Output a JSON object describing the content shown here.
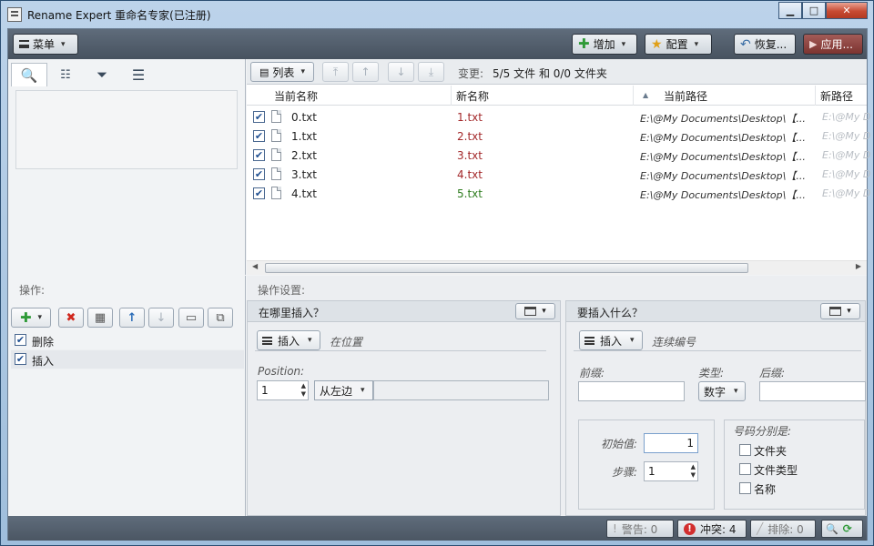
{
  "window": {
    "title": "Rename Expert 重命名专家(已注册)"
  },
  "toolbar": {
    "menu_label": "菜单",
    "add_label": "增加",
    "config_label": "配置",
    "restore_label": "恢复...",
    "apply_label": "应用..."
  },
  "left_tabs": [
    {
      "name": "search-icon"
    },
    {
      "name": "tree-icon"
    },
    {
      "name": "filter-icon"
    },
    {
      "name": "list-icon"
    }
  ],
  "filelist": {
    "view_label": "列表",
    "change_label": "变更:",
    "change_value": "5/5 文件 和 0/0 文件夹",
    "columns": [
      "当前名称",
      "新名称",
      "当前路径",
      "新路径"
    ],
    "rows": [
      {
        "checked": true,
        "current": "0.txt",
        "new": "1.txt",
        "new_color": "#a3282a",
        "path": "E:\\@My Documents\\Desktop\\【...",
        "new_path": "E:\\@My D"
      },
      {
        "checked": true,
        "current": "1.txt",
        "new": "2.txt",
        "new_color": "#a3282a",
        "path": "E:\\@My Documents\\Desktop\\【...",
        "new_path": "E:\\@My D"
      },
      {
        "checked": true,
        "current": "2.txt",
        "new": "3.txt",
        "new_color": "#a3282a",
        "path": "E:\\@My Documents\\Desktop\\【...",
        "new_path": "E:\\@My D"
      },
      {
        "checked": true,
        "current": "3.txt",
        "new": "4.txt",
        "new_color": "#a3282a",
        "path": "E:\\@My Documents\\Desktop\\【...",
        "new_path": "E:\\@My D"
      },
      {
        "checked": true,
        "current": "4.txt",
        "new": "5.txt",
        "new_color": "#2f7d1f",
        "path": "E:\\@My Documents\\Desktop\\【...",
        "new_path": "E:\\@My D"
      }
    ]
  },
  "operations": {
    "label": "操作:",
    "items": [
      {
        "checked": true,
        "name": "删除",
        "selected": false
      },
      {
        "checked": true,
        "name": "插入",
        "selected": true
      }
    ]
  },
  "settings": {
    "label": "操作设置:",
    "where": {
      "title": "在哪里插入？",
      "mode_label": "插入",
      "mode_desc": "在位置",
      "position_label": "Position:",
      "position_value": "1",
      "side_label": "从左边"
    },
    "what": {
      "title": "要插入什么？",
      "mode_label": "插入",
      "mode_desc": "连续编号",
      "prefix_label": "前缀:",
      "prefix_value": "",
      "type_label": "类型:",
      "type_value": "数字",
      "suffix_label": "后缀:",
      "suffix_value": "",
      "start_label": "初始值:",
      "start_value": "1",
      "step_label": "步骤:",
      "step_value": "1",
      "separate_label": "号码分别是:",
      "separate_options": [
        {
          "label": "文件夹",
          "checked": false
        },
        {
          "label": "文件类型",
          "checked": false
        },
        {
          "label": "名称",
          "checked": false
        }
      ]
    }
  },
  "statusbar": {
    "warnings": "警告: 0",
    "conflicts": "冲突: 4",
    "excluded": "排除: 0"
  }
}
